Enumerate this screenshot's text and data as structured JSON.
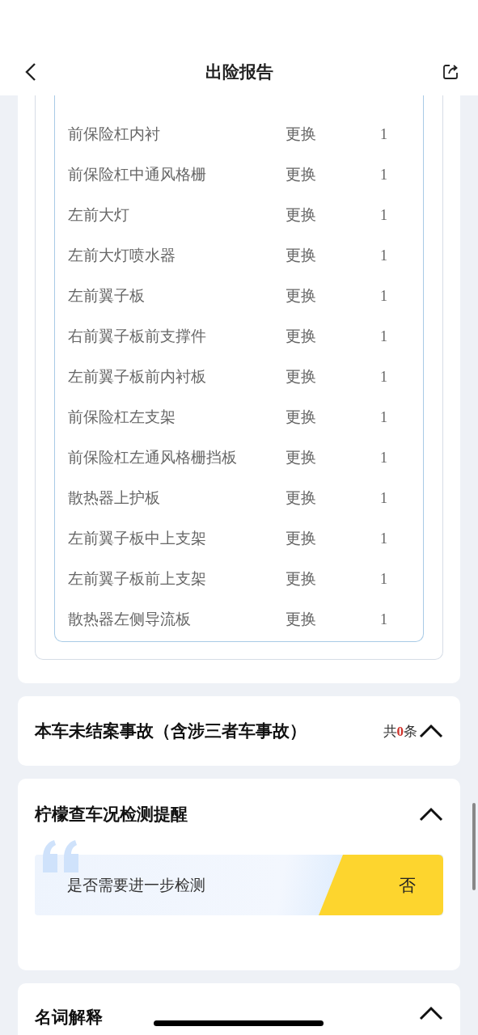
{
  "header": {
    "title": "出险报告"
  },
  "parts": [
    {
      "name": "前保险杠内衬",
      "action": "更换",
      "quantity": "1"
    },
    {
      "name": "前保险杠中通风格栅",
      "action": "更换",
      "quantity": "1"
    },
    {
      "name": "左前大灯",
      "action": "更换",
      "quantity": "1"
    },
    {
      "name": "左前大灯喷水器",
      "action": "更换",
      "quantity": "1"
    },
    {
      "name": "左前翼子板",
      "action": "更换",
      "quantity": "1"
    },
    {
      "name": "右前翼子板前支撑件",
      "action": "更换",
      "quantity": "1"
    },
    {
      "name": "左前翼子板前内衬板",
      "action": "更换",
      "quantity": "1"
    },
    {
      "name": "前保险杠左支架",
      "action": "更换",
      "quantity": "1"
    },
    {
      "name": "前保险杠左通风格栅挡板",
      "action": "更换",
      "quantity": "1"
    },
    {
      "name": "散热器上护板",
      "action": "更换",
      "quantity": "1"
    },
    {
      "name": "左前翼子板中上支架",
      "action": "更换",
      "quantity": "1"
    },
    {
      "name": "左前翼子板前上支架",
      "action": "更换",
      "quantity": "1"
    },
    {
      "name": "散热器左侧导流板",
      "action": "更换",
      "quantity": "1"
    }
  ],
  "accidents": {
    "title": "本车未结案事故（含涉三者车事故）",
    "count_prefix": "共",
    "count": "0",
    "count_suffix": "条",
    "expanded": true
  },
  "inspection": {
    "title": "柠檬查车况检测提醒",
    "expanded": true,
    "question": "是否需要进一步检测",
    "answer": "否"
  },
  "glossary": {
    "title": "名词解释",
    "expanded": true
  }
}
